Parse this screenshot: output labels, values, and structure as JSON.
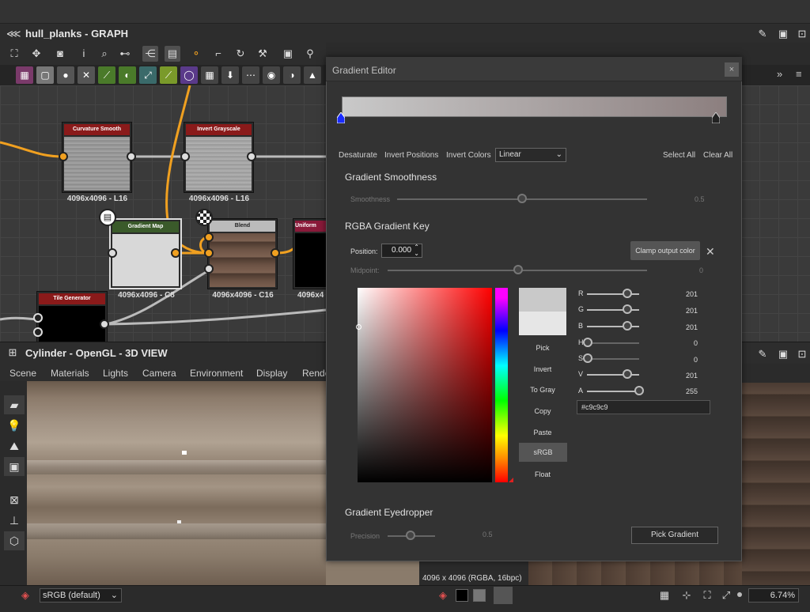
{
  "graph_panel": {
    "title": "hull_planks - GRAPH"
  },
  "nodes": [
    {
      "title": "Curvature Smooth",
      "res": "4096x4096 - L16"
    },
    {
      "title": "Invert Grayscale",
      "res": "4096x4096 - L16"
    },
    {
      "title": "Gradient Map",
      "res": "4096x4096 - C8"
    },
    {
      "title": "Blend",
      "res": "4096x4096 - C16"
    },
    {
      "title": "Uniform",
      "res": "4096x4"
    },
    {
      "title": "Tile Generator",
      "res": ""
    }
  ],
  "view_panel": {
    "title": "Cylinder - OpenGL - 3D VIEW",
    "menu": [
      "Scene",
      "Materials",
      "Lights",
      "Camera",
      "Environment",
      "Display",
      "Rende"
    ],
    "resolution_label": "4096 x 4096 (RGBA, 16bpc)"
  },
  "bottom_bar": {
    "colorspace": "sRGB (default)",
    "zoom": "6.74%"
  },
  "gradient_editor": {
    "title": "Gradient Editor",
    "close": "×",
    "actions": [
      "Desaturate",
      "Invert Positions",
      "Invert Colors"
    ],
    "interpolation": "Linear",
    "select_all": "Select All",
    "clear_all": "Clear All",
    "smoothness_section": "Gradient Smoothness",
    "smoothness_label": "Smoothness",
    "smoothness_value": "0.5",
    "key_section": "RGBA Gradient Key",
    "position_label": "Position:",
    "position_value": "0.000",
    "clamp_button": "Clamp output color",
    "midpoint_label": "Midpoint:",
    "midpoint_value": "0",
    "side_buttons": [
      "Pick",
      "Invert",
      "To Gray",
      "Copy",
      "Paste",
      "sRGB",
      "Float"
    ],
    "channels": [
      {
        "label": "R",
        "value": "201"
      },
      {
        "label": "G",
        "value": "201"
      },
      {
        "label": "B",
        "value": "201"
      },
      {
        "label": "H",
        "value": "0"
      },
      {
        "label": "S",
        "value": "0"
      },
      {
        "label": "V",
        "value": "201"
      },
      {
        "label": "A",
        "value": "255"
      }
    ],
    "hex": "#c9c9c9",
    "eyedropper_section": "Gradient Eyedropper",
    "precision_label": "Precision",
    "precision_value": "0.5",
    "pick_gradient_button": "Pick Gradient",
    "colors": {
      "gradient_start": "#c9c9c9",
      "gradient_end": "#8c7f7f",
      "selected_stop": "#1a2cff"
    }
  }
}
